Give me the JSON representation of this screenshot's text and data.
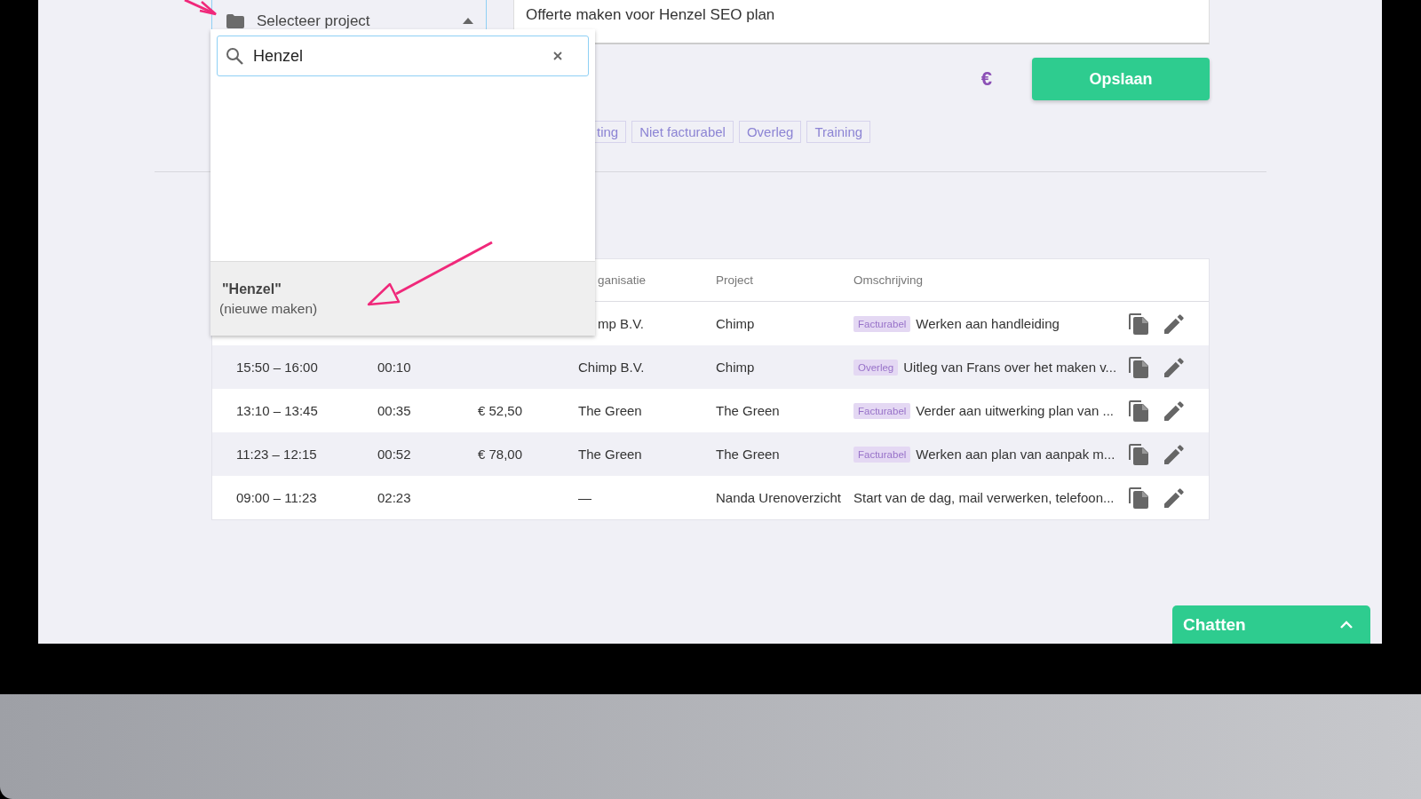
{
  "project_select": {
    "label": "Selecteer project",
    "expanded": true
  },
  "dropdown": {
    "search_value": "Henzel",
    "option_title": "\"Henzel\"",
    "option_note": "(nieuwe maken)"
  },
  "description_field": {
    "value": "Offerte maken voor Henzel SEO plan"
  },
  "currency_icon": "€",
  "save_button": "Opslaan",
  "tags": [
    {
      "label": "ting"
    },
    {
      "label": "Niet facturabel"
    },
    {
      "label": "Overleg"
    },
    {
      "label": "Training"
    }
  ],
  "table": {
    "columns": [
      "",
      "",
      "",
      "ganisatie",
      "Project",
      "Omschrijving"
    ],
    "rows": [
      {
        "organisation": "mp B.V.",
        "project": "Chimp",
        "tag": "Facturabel",
        "description": "Werken aan handleiding"
      },
      {
        "time": "15:50 – 16:00",
        "duration": "00:10",
        "organisation": "Chimp B.V.",
        "project": "Chimp",
        "tag": "Overleg",
        "description": "Uitleg van Frans over het maken v..."
      },
      {
        "time": "13:10 – 13:45",
        "duration": "00:35",
        "amount": "€ 52,50",
        "organisation": "The Green",
        "project": "The Green",
        "tag": "Facturabel",
        "description": "Verder aan uitwerking plan van ..."
      },
      {
        "time": "11:23 – 12:15",
        "duration": "00:52",
        "amount": "€ 78,00",
        "organisation": "The Green",
        "project": "The Green",
        "tag": "Facturabel",
        "description": "Werken aan plan van aanpak m..."
      },
      {
        "time": "09:00 – 11:23",
        "duration": "02:23",
        "organisation": "—",
        "project": "Nanda Urenoverzicht",
        "description": "Start van de dag, mail verwerken, telefoon..."
      }
    ]
  },
  "chat": {
    "label": "Chatten",
    "expanded": false
  }
}
